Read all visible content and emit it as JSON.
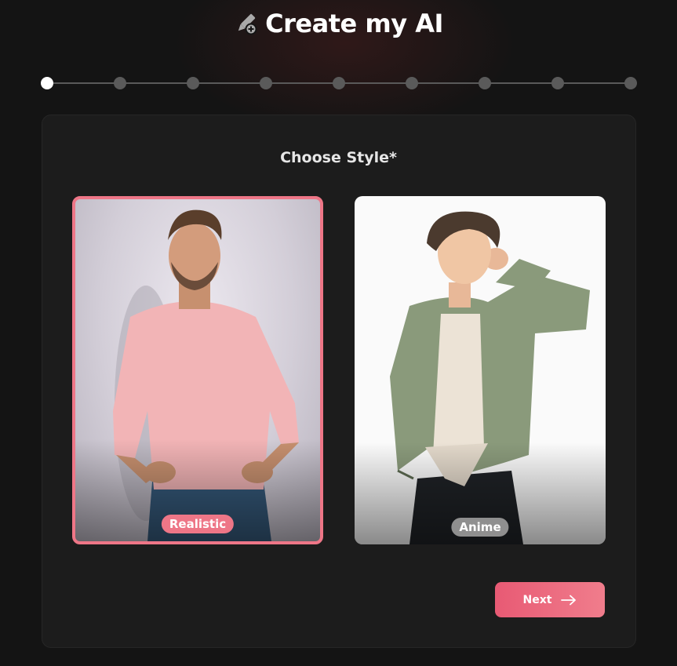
{
  "header": {
    "title": "Create my AI",
    "icon": "pencil-plus-icon"
  },
  "stepper": {
    "total_steps": 9,
    "current_step": 1
  },
  "card": {
    "title": "Choose Style*"
  },
  "styles": [
    {
      "label": "Realistic",
      "selected": true
    },
    {
      "label": "Anime",
      "selected": false
    }
  ],
  "actions": {
    "next_label": "Next",
    "next_icon": "arrow-right-icon"
  },
  "colors": {
    "accent": "#ee7687",
    "background": "#141414",
    "card": "#1c1c1c",
    "inactive_step": "#5a5a5a"
  }
}
